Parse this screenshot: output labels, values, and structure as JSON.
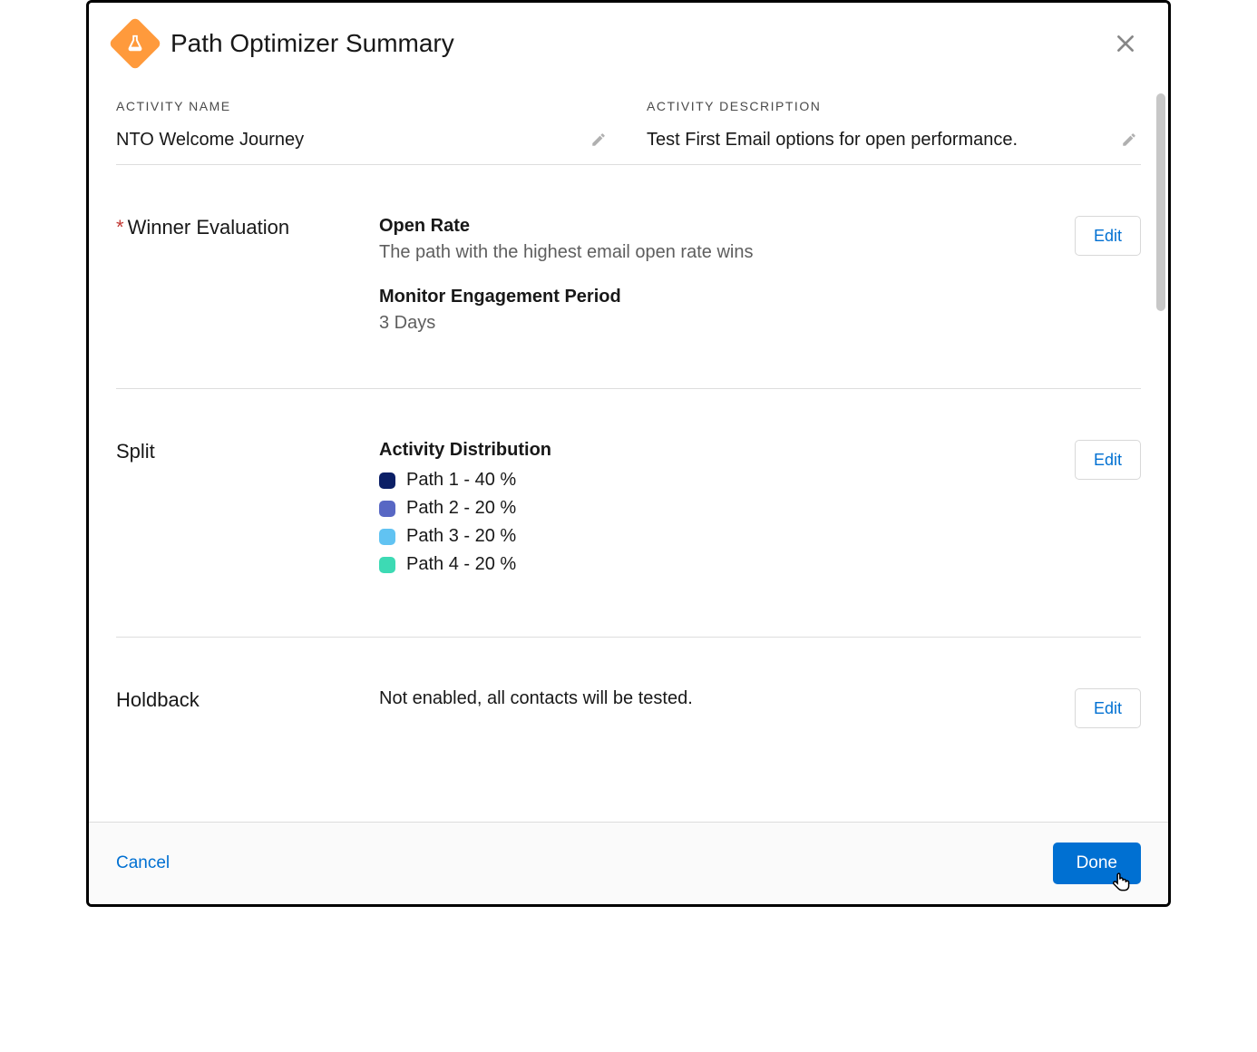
{
  "header": {
    "title": "Path Optimizer Summary"
  },
  "meta": {
    "activity_name_label": "ACTIVITY NAME",
    "activity_name_value": "NTO Welcome Journey",
    "activity_desc_label": "ACTIVITY DESCRIPTION",
    "activity_desc_value": "Test First Email options for open performance."
  },
  "winner": {
    "section_label": "Winner Evaluation",
    "metric_title": "Open Rate",
    "metric_desc": "The path with the highest email open rate wins",
    "period_title": "Monitor Engagement Period",
    "period_value": "3 Days",
    "edit_label": "Edit"
  },
  "split": {
    "section_label": "Split",
    "dist_title": "Activity Distribution",
    "paths": [
      {
        "label": "Path 1 - 40 %",
        "color": "#0b1f66"
      },
      {
        "label": "Path 2 - 20 %",
        "color": "#5867c4"
      },
      {
        "label": "Path 3 - 20 %",
        "color": "#61c3f2"
      },
      {
        "label": "Path 4 - 20 %",
        "color": "#3ddab4"
      }
    ],
    "edit_label": "Edit"
  },
  "holdback": {
    "section_label": "Holdback",
    "value": "Not enabled, all contacts will be tested.",
    "edit_label": "Edit"
  },
  "footer": {
    "cancel": "Cancel",
    "done": "Done"
  },
  "chart_data": {
    "type": "bar",
    "title": "Activity Distribution",
    "categories": [
      "Path 1",
      "Path 2",
      "Path 3",
      "Path 4"
    ],
    "values": [
      40,
      20,
      20,
      20
    ],
    "ylabel": "Percent",
    "ylim": [
      0,
      100
    ]
  }
}
